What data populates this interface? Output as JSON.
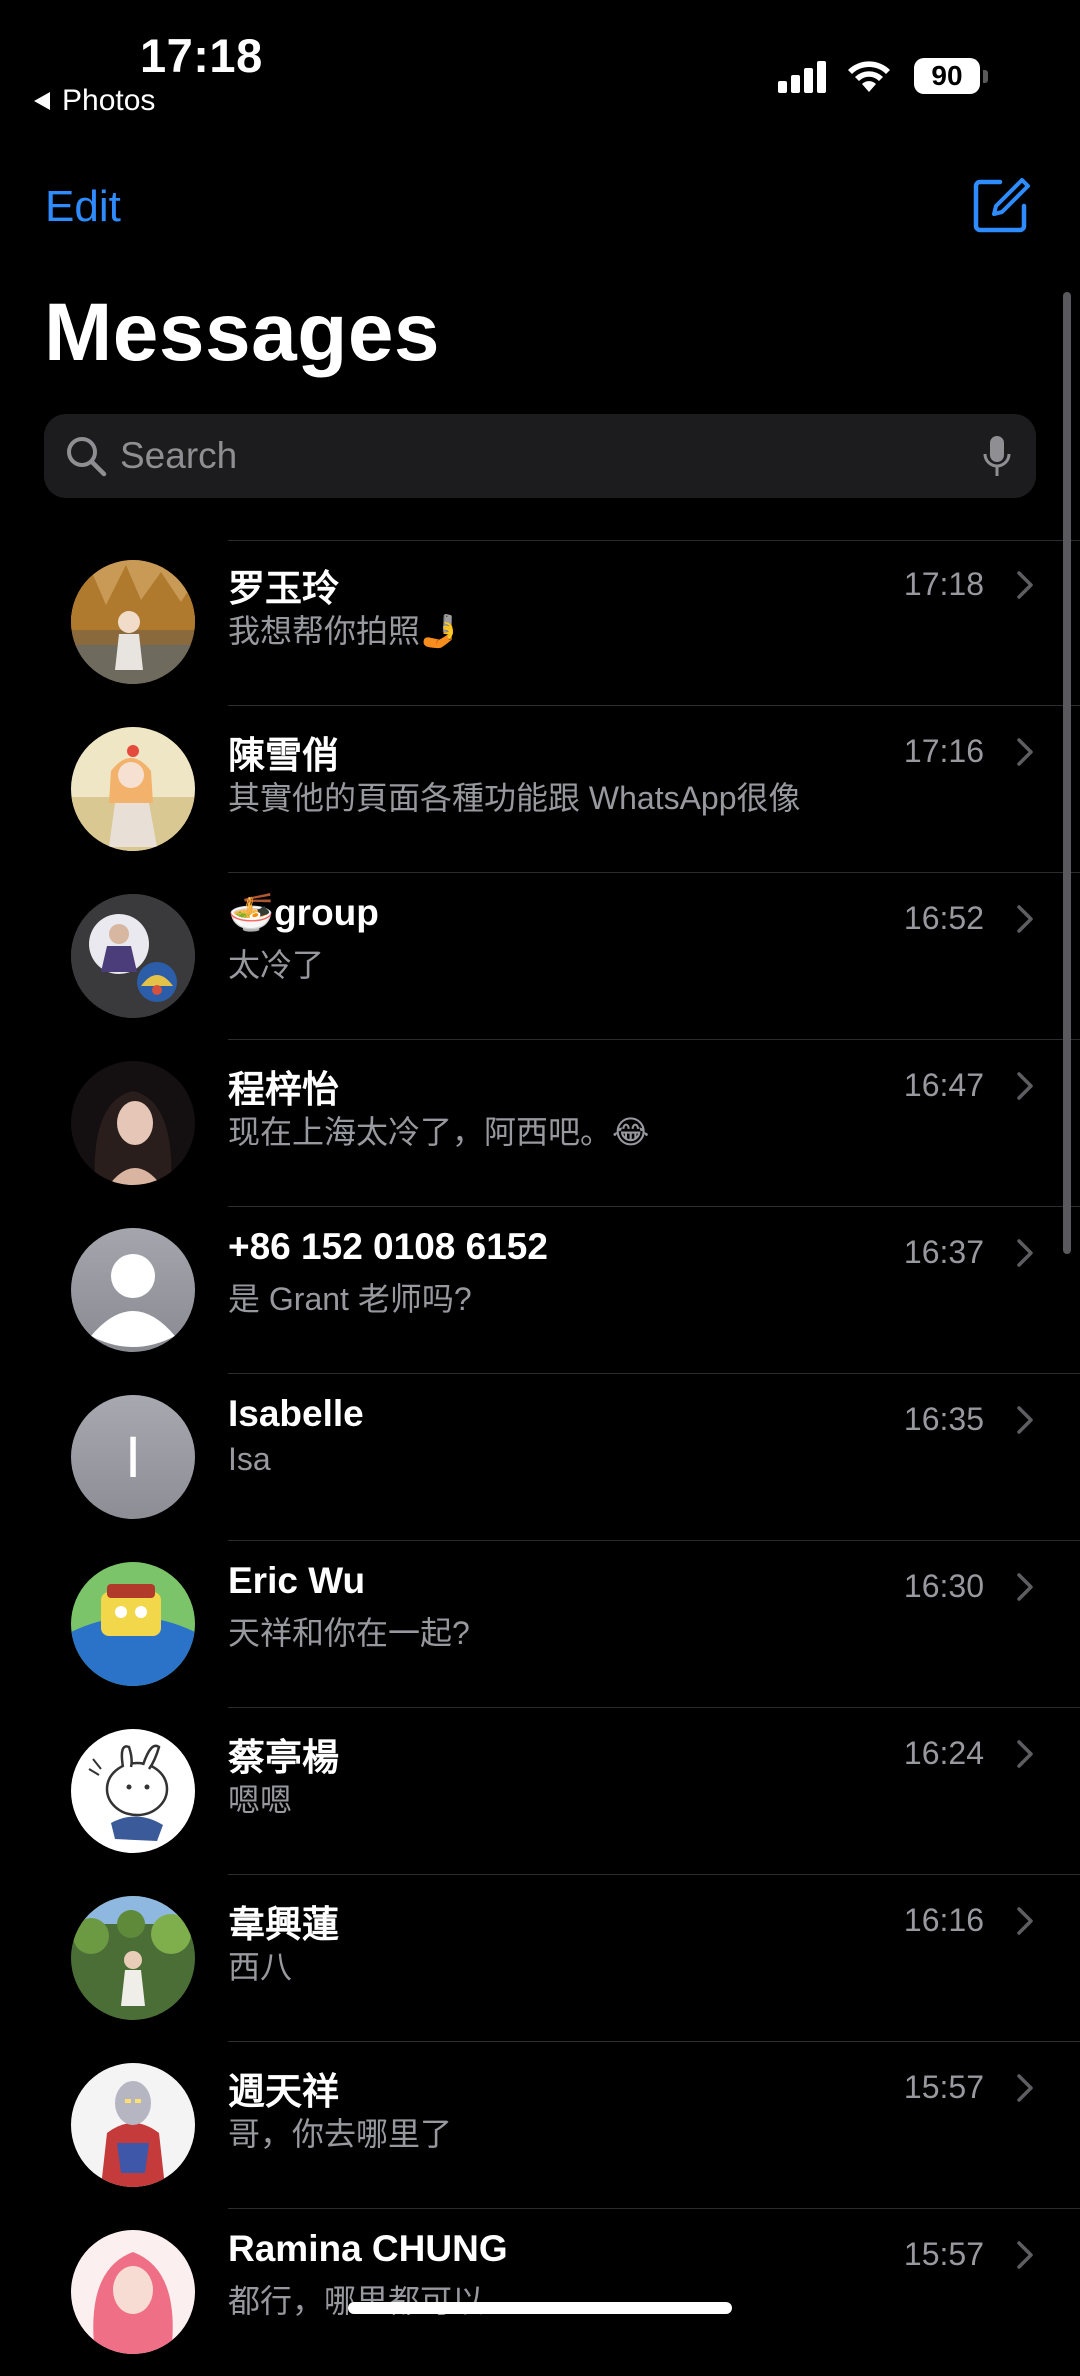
{
  "status_bar": {
    "time": "17:18",
    "back_app": "Photos",
    "battery": "90"
  },
  "nav": {
    "edit_label": "Edit",
    "title": "Messages",
    "compose_icon": "compose-icon"
  },
  "search": {
    "placeholder": "Search",
    "value": ""
  },
  "conversations": [
    {
      "name": "罗玉玲",
      "preview": "我想帮你拍照🤳",
      "time": "17:18"
    },
    {
      "name": "陳雪俏",
      "preview": "其實他的頁面各種功能跟 WhatsApp很像",
      "time": "17:16"
    },
    {
      "name": "🍜group",
      "preview": "太冷了",
      "time": "16:52"
    },
    {
      "name": "程梓怡",
      "preview": "现在上海太冷了，阿西吧。😂",
      "time": "16:47"
    },
    {
      "name": "+86 152 0108 6152",
      "preview": "是 Grant 老师吗?",
      "time": "16:37"
    },
    {
      "name": "Isabelle",
      "preview": "Isa",
      "time": "16:35",
      "initial": "I"
    },
    {
      "name": "Eric Wu",
      "preview": "天祥和你在一起?",
      "time": "16:30"
    },
    {
      "name": "蔡亭楊",
      "preview": "嗯嗯",
      "time": "16:24"
    },
    {
      "name": "韋興蓮",
      "preview": "西八",
      "time": "16:16"
    },
    {
      "name": "週天祥",
      "preview": "哥，你去哪里了",
      "time": "15:57"
    },
    {
      "name": "Ramina CHUNG",
      "preview": "都行，哪里都可以",
      "time": "15:57"
    }
  ],
  "colors": {
    "accent": "#2f8cff",
    "background": "#000000",
    "secondary_text": "#98989f",
    "search_bg": "#1c1c1e"
  }
}
